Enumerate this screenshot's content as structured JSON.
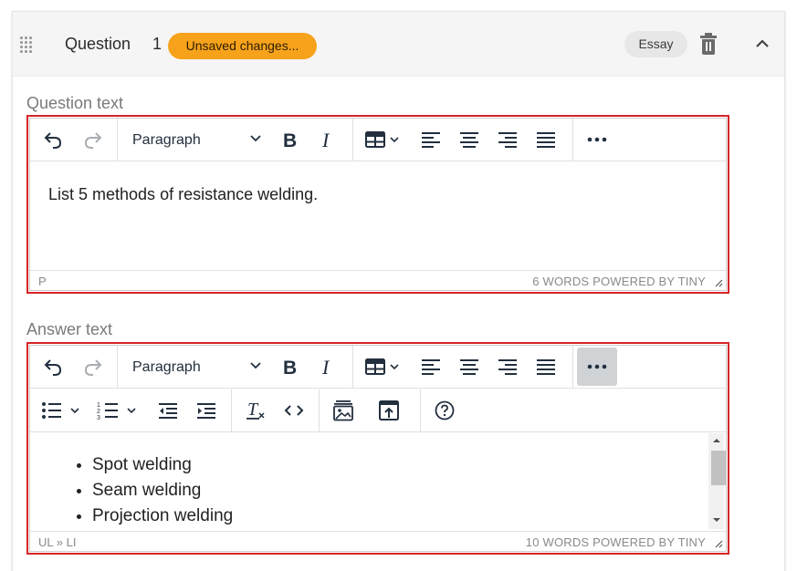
{
  "header": {
    "title": "Question",
    "number": "1",
    "badge": "Unsaved changes...",
    "type": "Essay"
  },
  "question_field": {
    "label": "Question text",
    "block_format": "Paragraph",
    "content": "List 5 methods of resistance welding.",
    "status_path": "P",
    "status_words": "6 WORDS  POWERED BY TINY"
  },
  "answer_field": {
    "label": "Answer text",
    "block_format": "Paragraph",
    "items": [
      "Spot welding",
      "Seam welding",
      "Projection welding"
    ],
    "status_path": "UL » LI",
    "status_words": "10 WORDS  POWERED BY TINY"
  },
  "colors": {
    "badge": "#f7a21b",
    "editor_outline": "#d62528",
    "active_button": "#cfd3d6",
    "icon": "#222f3e"
  },
  "icons": [
    "drag-icon",
    "trash-icon",
    "chevron-up-icon",
    "undo-icon",
    "redo-icon",
    "chevron-down-icon",
    "bold-icon",
    "italic-icon",
    "table-icon",
    "align-left-icon",
    "align-center-icon",
    "align-right-icon",
    "align-justify-icon",
    "more-icon",
    "bullet-list-icon",
    "numbered-list-icon",
    "outdent-icon",
    "indent-icon",
    "clear-format-icon",
    "code-icon",
    "image-icon",
    "upload-icon",
    "help-icon",
    "resize-grip-icon"
  ]
}
